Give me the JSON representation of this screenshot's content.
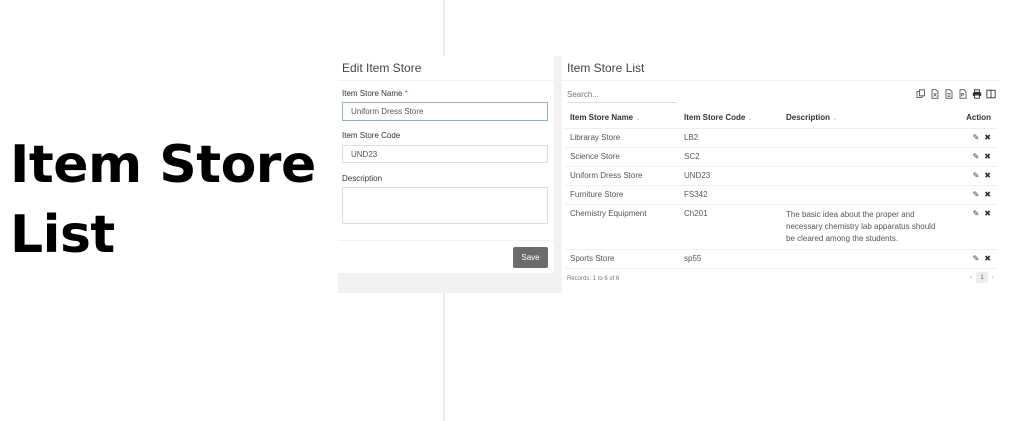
{
  "page": {
    "heading": "Item Store List"
  },
  "edit": {
    "title": "Edit Item Store",
    "name_label": "Item Store Name",
    "required_mark": "*",
    "name_value": "Uniform Dress Store",
    "code_label": "Item Store Code",
    "code_value": "UND23",
    "desc_label": "Description",
    "desc_value": "",
    "save_label": "Save"
  },
  "list": {
    "title": "Item Store List",
    "search_placeholder": "Search...",
    "tools": [
      "copy-icon",
      "excel-icon",
      "csv-icon",
      "pdf-icon",
      "print-icon",
      "columns-icon"
    ],
    "columns": [
      "Item Store Name",
      "Item Store Code",
      "Description",
      "Action"
    ],
    "sort_glyph": "⌄",
    "rows": [
      {
        "name": "Libraray Store",
        "code": "LB2",
        "description": ""
      },
      {
        "name": "Science Store",
        "code": "SC2",
        "description": ""
      },
      {
        "name": "Uniform Dress Store",
        "code": "UND23",
        "description": ""
      },
      {
        "name": "Furniture Store",
        "code": "FS342",
        "description": ""
      },
      {
        "name": "Chemistry Equipment",
        "code": "Ch201",
        "description": "The basic idea about the proper and necessary chemistry lab apparatus should be cleared among the students."
      },
      {
        "name": "Sports Store",
        "code": "sp55",
        "description": ""
      }
    ],
    "edit_glyph": "✎",
    "delete_glyph": "✖",
    "records": "Records: 1 to 6 of 6",
    "pager": {
      "prev": "‹",
      "page": "1",
      "next": "›"
    }
  }
}
